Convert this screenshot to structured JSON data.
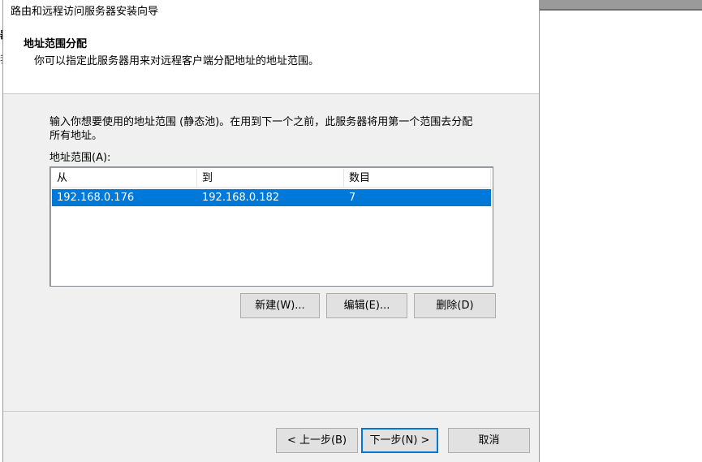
{
  "window": {
    "title": "路由和远程访问服务器安装向导"
  },
  "header": {
    "title": "地址范围分配",
    "subtitle": "你可以指定此服务器用来对远程客户端分配地址的地址范围。"
  },
  "main": {
    "instruction_line1": "输入你想要使用的地址范围 (静态池)。在用到下一个之前，此服务器将用第一个范围去分配",
    "instruction_line2": "所有地址。",
    "range_label": "地址范围(A):",
    "table": {
      "columns": [
        "从",
        "到",
        "数目"
      ],
      "rows": [
        {
          "from": "192.168.0.176",
          "to": "192.168.0.182",
          "count": "7",
          "selected": true
        }
      ]
    },
    "buttons": {
      "new": "新建(W)...",
      "edit": "编辑(E)...",
      "delete": "删除(D)"
    }
  },
  "footer": {
    "back": "< 上一步(B)",
    "next": "下一步(N) >",
    "cancel": "取消"
  },
  "colors": {
    "selection": "#0078d7",
    "dialog_bg": "#f0f0f0",
    "button_bg": "#e1e1e1"
  }
}
